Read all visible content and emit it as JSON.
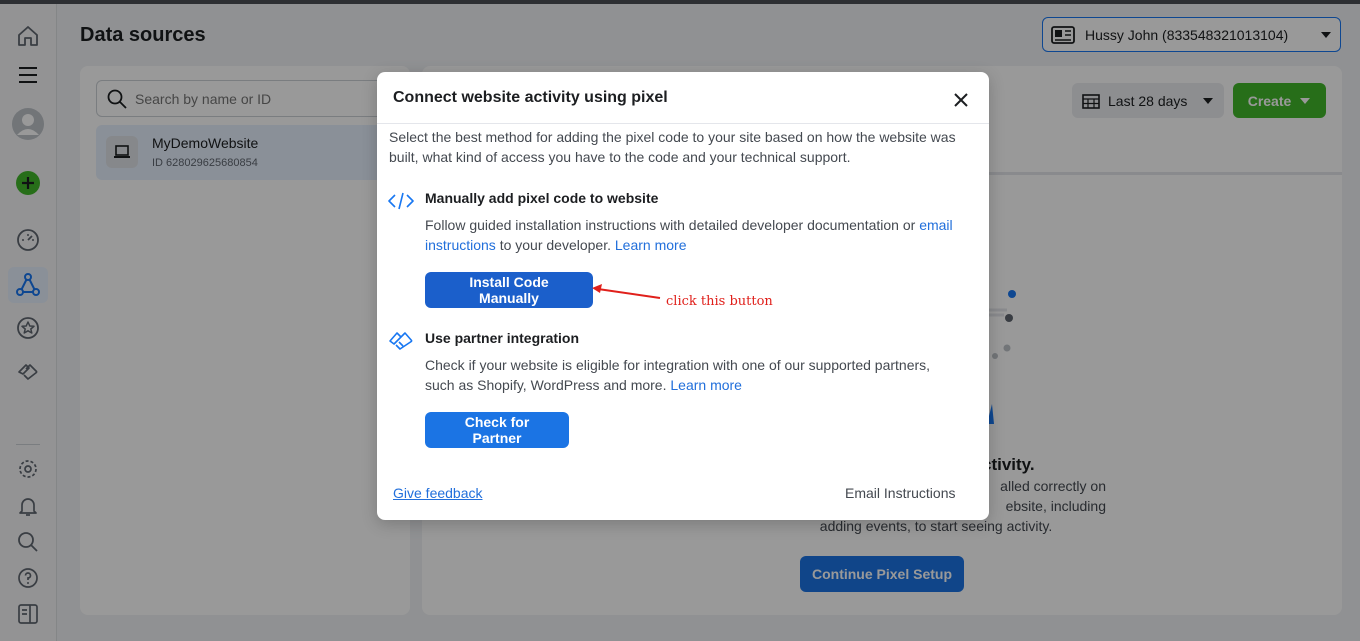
{
  "header": {
    "page_title": "Data sources",
    "account_label": "Hussy John (833548321013104)"
  },
  "rail": {
    "icons": [
      "home-icon",
      "menu-icon",
      "avatar",
      "add-icon",
      "dashboard-icon",
      "events-manager-icon",
      "star-icon",
      "partner-icon",
      "settings-icon",
      "bell-icon",
      "search-icon",
      "help-icon",
      "panel-icon"
    ]
  },
  "left_panel": {
    "search_placeholder": "Search by name or ID",
    "source": {
      "name": "MyDemoWebsite",
      "id": "ID 628029625680854"
    }
  },
  "right_panel": {
    "date_range": "Last 28 days",
    "create_label": "Create",
    "no_activity_title": "ctivity.",
    "no_activity_line1": "alled correctly on",
    "no_activity_line2": "ebsite, including",
    "no_activity_line3": "adding events, to start seeing activity.",
    "continue_label": "Continue Pixel Setup"
  },
  "modal": {
    "title": "Connect website activity using pixel",
    "intro": "Select the best method for adding the pixel code to your site based on how the website was built, what kind of access you have to the code and your technical support.",
    "manual": {
      "title": "Manually add pixel code to website",
      "desc_before": "Follow guided installation instructions with detailed developer documentation or ",
      "desc_link1": "email instructions",
      "desc_middle": " to your developer. ",
      "desc_link2": "Learn more",
      "button": "Install Code Manually"
    },
    "partner": {
      "title": "Use partner integration",
      "desc": "Check if your website is eligible for integration with one of our supported partners, such as Shopify, WordPress and more. ",
      "desc_link": "Learn more",
      "button": "Check for Partner"
    },
    "feedback": "Give feedback",
    "email_instructions": "Email Instructions"
  },
  "annotation": {
    "text": "click this button",
    "color": "#e0201b"
  }
}
